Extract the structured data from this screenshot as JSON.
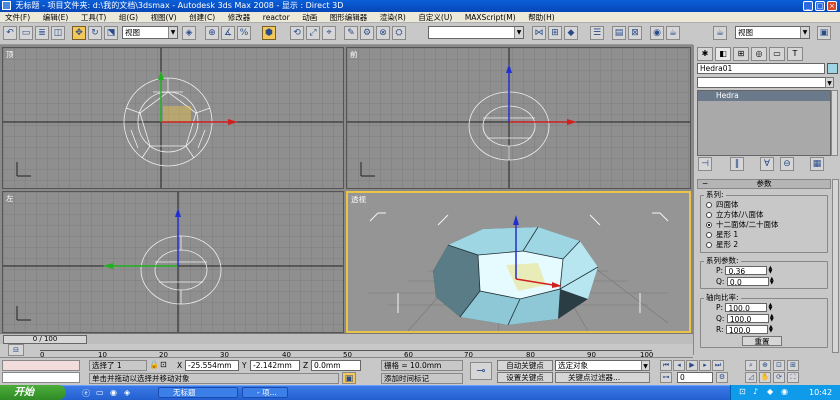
{
  "window": {
    "title": "无标题    - 项目文件夹: d:\\我的文档\\3dsmax    - Autodesk 3ds Max 2008    - 显示 : Direct 3D",
    "min": "_",
    "max": "□",
    "close": "×"
  },
  "menu": [
    "文件(F)",
    "编辑(E)",
    "工具(T)",
    "组(G)",
    "视图(V)",
    "创建(C)",
    "修改器",
    "reactor",
    "动画",
    "图形编辑器",
    "渲染(R)",
    "自定义(U)",
    "MAXScript(M)",
    "帮助(H)"
  ],
  "toolbar": {
    "ref_coord": "视图",
    "named_selection": "",
    "right_view": "视图"
  },
  "viewports": [
    {
      "label": "顶"
    },
    {
      "label": "前"
    },
    {
      "label": "左"
    },
    {
      "label": "透视"
    }
  ],
  "command_panel": {
    "object_name": "Hedra01",
    "modifier_dropdown": "",
    "stack_item": "Hedra",
    "rollout_title": "参数",
    "family_title": "系列:",
    "families": [
      {
        "label": "四面体",
        "checked": false
      },
      {
        "label": "立方体/八面体",
        "checked": false
      },
      {
        "label": "十二面体/二十面体",
        "checked": true
      },
      {
        "label": "星形 1",
        "checked": false
      },
      {
        "label": "星形 2",
        "checked": false
      }
    ],
    "family_params_title": "系列参数:",
    "family_params": [
      {
        "label": "P:",
        "value": "0.36"
      },
      {
        "label": "Q:",
        "value": "0.0"
      }
    ],
    "axis_ratio_title": "轴向比率:",
    "axis_ratio": [
      {
        "label": "P:",
        "value": "100.0"
      },
      {
        "label": "Q:",
        "value": "100.0"
      },
      {
        "label": "R:",
        "value": "100.0"
      }
    ],
    "reset": "重置"
  },
  "timeline": {
    "frame": "0 / 100",
    "ticks": [
      "0",
      "10",
      "20",
      "30",
      "40",
      "50",
      "60",
      "70",
      "80",
      "90",
      "100"
    ]
  },
  "status": {
    "selected": "选择了 1",
    "x_label": "X",
    "x": "-25.554mm",
    "y_label": "Y",
    "y": "-2.142mm",
    "z_label": "Z",
    "z": "0.0mm",
    "grid": "栅格 = 10.0mm",
    "auto_key": "自动关键点",
    "set_key": "设置关键点",
    "selection_dropdown": "选定对象",
    "key_filters": "关键点过滤器...",
    "frame_spinner": "0",
    "prompt": "单击并拖动以选择并移动对象",
    "add_time_tag": "添加时间标记"
  },
  "taskbar": {
    "start": "开始",
    "item": "无标题",
    "item2": "- 项...",
    "clock": "10:42"
  }
}
